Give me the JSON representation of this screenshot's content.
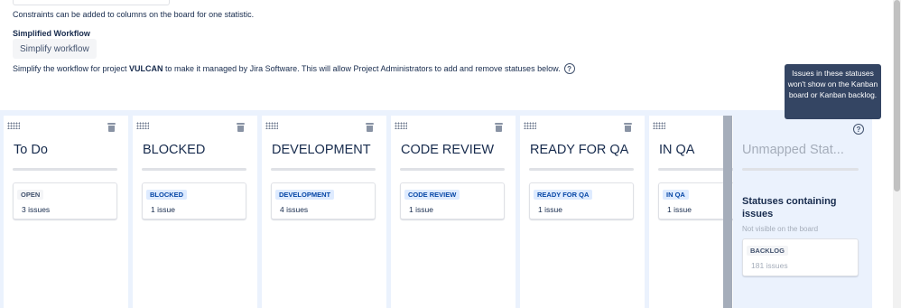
{
  "constraints": {
    "help_text": "Constraints can be added to columns on the board for one statistic."
  },
  "simplified_workflow": {
    "heading": "Simplified Workflow",
    "button_label": "Simplify workflow",
    "desc_prefix": "Simplify the workflow for project ",
    "project": "VULCAN",
    "desc_suffix": " to make it managed by Jira Software. This will allow Project Administrators to add and remove statuses below.",
    "help_glyph": "?"
  },
  "columns": [
    {
      "title": "To Do",
      "status": "OPEN",
      "count": "3 issues",
      "lozenge": "grey"
    },
    {
      "title": "BLOCKED",
      "status": "BLOCKED",
      "count": "1 issue",
      "lozenge": "blue"
    },
    {
      "title": "DEVELOPMENT",
      "status": "DEVELOPMENT",
      "count": "4 issues",
      "lozenge": "blue"
    },
    {
      "title": "CODE REVIEW",
      "status": "CODE REVIEW",
      "count": "1 issue",
      "lozenge": "blue"
    },
    {
      "title": "READY FOR QA",
      "status": "READY FOR QA",
      "count": "1 issue",
      "lozenge": "blue"
    },
    {
      "title": "IN QA",
      "status": "IN QA",
      "count": "1 issue",
      "lozenge": "blue"
    }
  ],
  "unmapped": {
    "title": "Unmapped Stat...",
    "help_glyph": "?",
    "heading": "Statuses containing issues",
    "subtext": "Not visible on the board",
    "status": "BACKLOG",
    "count": "181 issues"
  },
  "tooltip": {
    "text": "Issues in these statuses won't show on the Kanban board or Kanban backlog."
  },
  "icons": {
    "column_drag": "drag-handle-icon",
    "column_delete": "trash-icon",
    "help": "question-circle-icon"
  },
  "colors": {
    "board_bg": "#ebf2fd",
    "lozenge_blue_bg": "#deebff",
    "lozenge_blue_text": "#0747a6",
    "lozenge_grey_bg": "#f4f5f7",
    "tooltip_bg": "#344563"
  }
}
